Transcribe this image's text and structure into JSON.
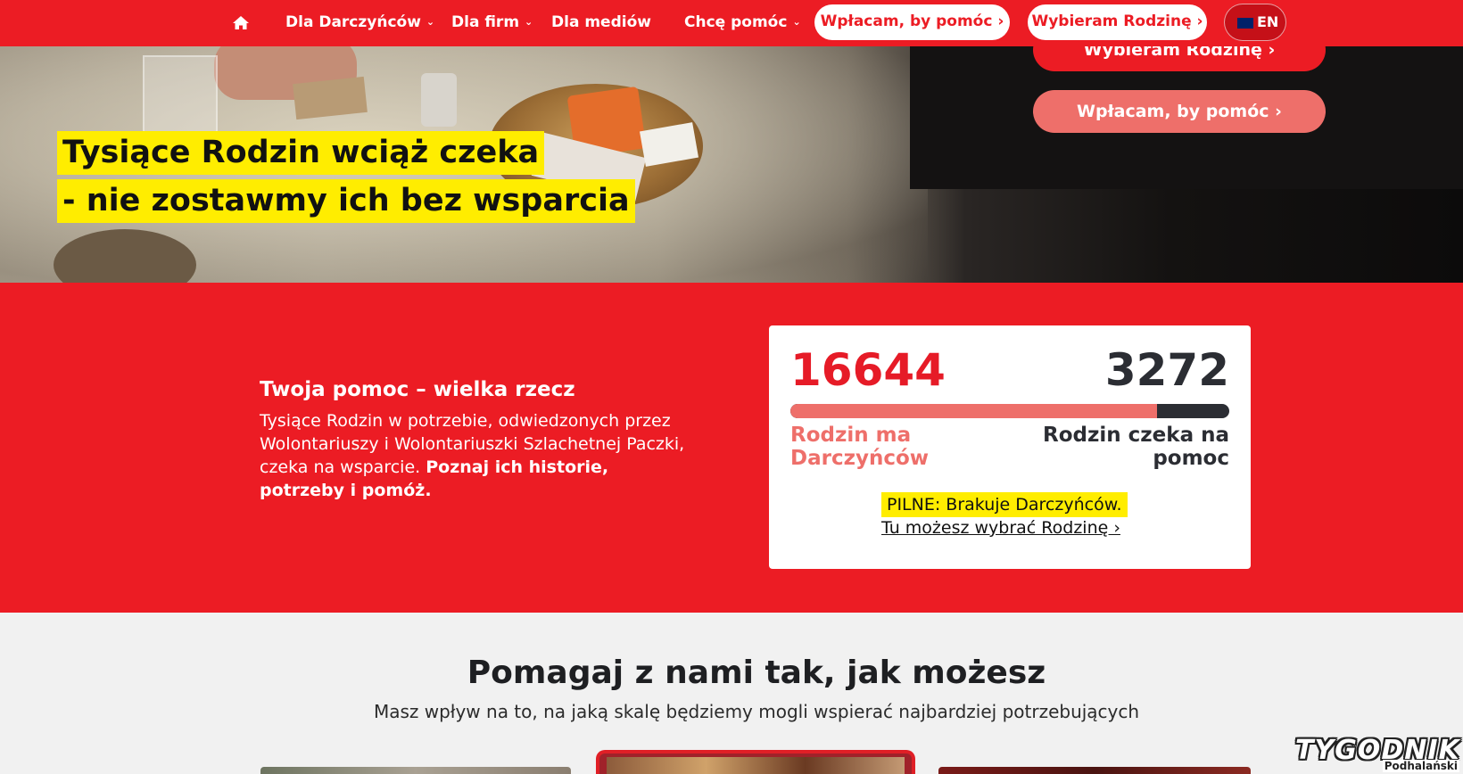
{
  "nav": {
    "home_icon": "home-icon",
    "items": [
      {
        "label": "Dla Darczyńców",
        "dropdown": true
      },
      {
        "label": "Dla firm",
        "dropdown": true
      },
      {
        "label": "Dla mediów",
        "dropdown": false
      },
      {
        "label": "Chcę pomóc",
        "dropdown": true
      }
    ],
    "donate_button": "Wpłacam, by pomóc ›",
    "choose_family_button": "Wybieram Rodzinę ›",
    "language": "EN",
    "language_icon": "uk-flag-icon",
    "colors": {
      "bar": "#ec1c24",
      "pill_bg": "#ffffff",
      "pill_text": "#ec1c24"
    }
  },
  "hero": {
    "title_line1": "Tysiące Rodzin wciąż czeka",
    "title_line2": "- nie zostawmy ich bez wsparcia",
    "button_choose_family": "Wybieram Rodzinę ›",
    "button_donate": "Wpłacam, by pomóc ›",
    "colors": {
      "highlight": "#ffed00",
      "button_choose": "#ec1c24",
      "button_donate": "#ee6f6a"
    }
  },
  "stats": {
    "heading": "Twoja pomoc – wielka rzecz",
    "text_plain": "Tysiące Rodzin w potrzebie, odwiedzonych przez Wolontariuszy i Wolontariuszki Szlachetnej Paczki, czeka na wsparcie. ",
    "text_bold": "Poznaj ich historie, potrzeby i pomóż.",
    "families_with_donors": "16644",
    "families_waiting": "3272",
    "progress_fraction": 0.836,
    "label_with_donors": "Rodzin ma Darczyńców",
    "label_waiting": "Rodzin czeka na pomoc",
    "urgent_text": "PILNE: Brakuje Darczyńców.",
    "choose_link": "Tu możesz wybrać Rodzinę ›",
    "colors": {
      "background": "#ec1c24",
      "accent": "#e61b27",
      "progress_fill": "#ee6f6a",
      "progress_rest": "#2b2d33"
    }
  },
  "section": {
    "title": "Pomagaj z nami tak, jak możesz",
    "subtitle": "Masz wpływ na to, na jaką skalę będziemy mogli wspierać najbardziej potrzebujących"
  },
  "watermark": {
    "main": "TYGODNIK",
    "sub": "Podhalański"
  }
}
